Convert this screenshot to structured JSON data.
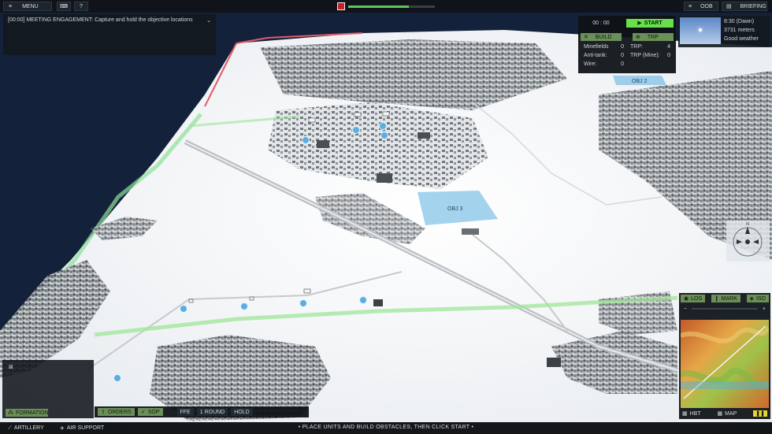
{
  "topbar": {
    "menu_label": "MENU",
    "help_label": "?",
    "oob_label": "OOB",
    "briefing_label": "BRIEFING",
    "progress": 0.7
  },
  "objective": {
    "text": "[00:00] MEETING ENGAGEMENT: Capture and hold the objective locations"
  },
  "setup": {
    "timer": "00 : 00",
    "start_label": "START",
    "build_label": "BUILD",
    "trp_label": "TRP",
    "counts": [
      {
        "label": "Minefields",
        "value": "0"
      },
      {
        "label": "TRP:",
        "value": "4"
      },
      {
        "label": "Anti-tank:",
        "value": "0"
      },
      {
        "label": "TRP (Mine):",
        "value": "0"
      },
      {
        "label": "Wire:",
        "value": "0"
      },
      {
        "label": "",
        "value": ""
      }
    ]
  },
  "weather": {
    "time": "8:30 (Dawn)",
    "visibility": "3731 meters",
    "condition": "Good weather"
  },
  "map_labels": {
    "obj2": "OBJ 2",
    "obj3": "OBJ 3"
  },
  "compass": {
    "north": "N"
  },
  "minimap": {
    "los_label": "LOS",
    "mark_label": "MARK",
    "iso_label": "ISO",
    "minus": "−",
    "plus": "+",
    "hbt_label": "HBT",
    "map_label": "MAP"
  },
  "unit_panel": {
    "formation_label": "FORMATION"
  },
  "commands": {
    "orders_label": "ORDERS",
    "sop_label": "SOP",
    "ffe_label": "FFE",
    "round_label": "1 ROUND",
    "hold_label": "HOLD"
  },
  "bottom": {
    "artillery_label": "ARTILLERY",
    "airsupport_label": "AIR SUPPORT",
    "instruction": "PLACE UNITS AND BUILD OBSTACLES, THEN CLICK START"
  },
  "colors": {
    "accent_green": "#67e04c",
    "muted_green": "#6b8f58",
    "objective_blue": "#5aaee0",
    "flag_red": "#c81e2a"
  }
}
